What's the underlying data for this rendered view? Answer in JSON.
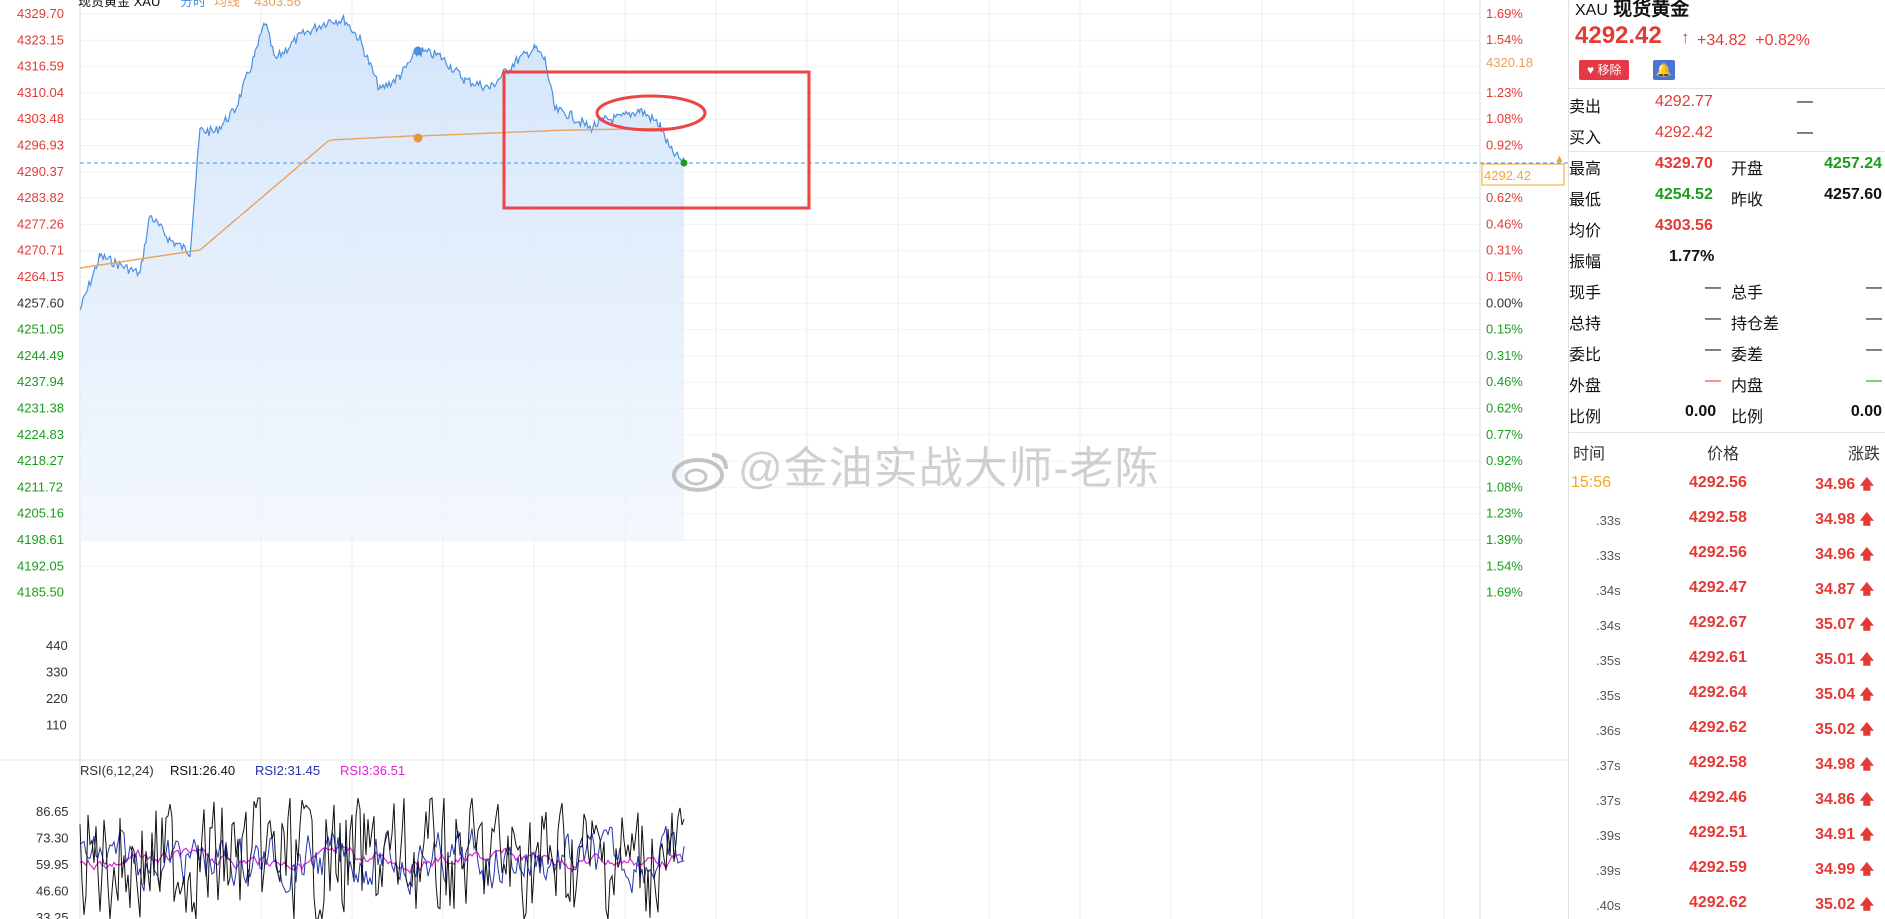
{
  "chart_header": {
    "title": "现货黄金 XAU",
    "legend_time_label": "分时",
    "legend_avg_label": "均线",
    "legend_avg_value": "4303.56"
  },
  "price_axis": {
    "left_ticks": [
      "4329.70",
      "4323.15",
      "4316.59",
      "4310.04",
      "4303.48",
      "4296.93",
      "4290.37",
      "4283.82",
      "4277.26",
      "4270.71",
      "4264.15",
      "4257.60",
      "4251.05",
      "4244.49",
      "4237.94",
      "4231.38",
      "4224.83",
      "4218.27",
      "4211.72",
      "4205.16",
      "4198.61",
      "4192.05",
      "4185.50"
    ],
    "right_ticks": [
      "1.69%",
      "1.54%",
      "1.23%",
      "1.08%",
      "0.92%",
      "0.77%",
      "0.62%",
      "0.46%",
      "0.31%",
      "0.15%",
      "0.00%",
      "0.15%",
      "0.31%",
      "0.46%",
      "0.62%",
      "0.77%",
      "0.92%",
      "1.08%",
      "1.23%",
      "1.39%",
      "1.54%",
      "1.69%"
    ],
    "avg_price_label": "4320.18",
    "current_price_label": "4292.42"
  },
  "volume_axis": {
    "ticks": [
      "440",
      "330",
      "220",
      "110"
    ]
  },
  "rsi": {
    "label": "RSI(6,12,24)",
    "rsi1": "RSI1:26.40",
    "rsi2": "RSI2:31.45",
    "rsi3": "RSI3:36.51",
    "ticks": [
      "86.65",
      "73.30",
      "59.95",
      "46.60",
      "33.25"
    ]
  },
  "colors": {
    "up": "#e53935",
    "down": "#1a9e1a",
    "price_line": "#4a90e2",
    "avg_line": "#e8a25c",
    "rsi1": "#111111",
    "rsi2": "#2233aa",
    "rsi3": "#dd22dd",
    "annotation": "#ee4444"
  },
  "watermark": "@金油实战大师-老陈",
  "side_panel": {
    "symbol": "XAU",
    "name": "现货黄金",
    "price": "4292.42",
    "change": "+34.82",
    "change_pct": "+0.82%",
    "remove_label": "移除",
    "bell_icon": "bell-icon",
    "sell_label": "卖出",
    "sell_price": "4292.77",
    "sell_vol": "—",
    "buy_label": "买入",
    "buy_price": "4292.42",
    "buy_vol": "—",
    "high_label": "最高",
    "high": "4329.70",
    "open_label": "开盘",
    "open": "4257.24",
    "low_label": "最低",
    "low": "4254.52",
    "prev_close_label": "昨收",
    "prev_close": "4257.60",
    "avg_label": "均价",
    "avg": "4303.56",
    "amplitude_label": "振幅",
    "amplitude": "1.77%",
    "cur_hand_label": "现手",
    "cur_hand": "—",
    "total_hand_label": "总手",
    "total_hand": "—",
    "total_hold_label": "总持",
    "total_hold": "—",
    "hold_diff_label": "持仓差",
    "hold_diff": "—",
    "entrust_ratio_label": "委比",
    "entrust_ratio": "—",
    "entrust_diff_label": "委差",
    "entrust_diff": "—",
    "outer_label": "外盘",
    "outer": "—",
    "inner_label": "内盘",
    "inner": "—",
    "ratio_label_1": "比例",
    "ratio_1": "0.00",
    "ratio_label_2": "比例",
    "ratio_2": "0.00",
    "ticks_header": {
      "time": "时间",
      "price": "价格",
      "change": "涨跌"
    },
    "ticks": [
      {
        "time": "15:56",
        "price": "4292.56",
        "change": "34.96"
      },
      {
        "time": ".33s",
        "price": "4292.58",
        "change": "34.98"
      },
      {
        "time": ".33s",
        "price": "4292.56",
        "change": "34.96"
      },
      {
        "time": ".34s",
        "price": "4292.47",
        "change": "34.87"
      },
      {
        "time": ".34s",
        "price": "4292.67",
        "change": "35.07"
      },
      {
        "time": ".35s",
        "price": "4292.61",
        "change": "35.01"
      },
      {
        "time": ".35s",
        "price": "4292.64",
        "change": "35.04"
      },
      {
        "time": ".36s",
        "price": "4292.62",
        "change": "35.02"
      },
      {
        "time": ".37s",
        "price": "4292.58",
        "change": "34.98"
      },
      {
        "time": ".37s",
        "price": "4292.46",
        "change": "34.86"
      },
      {
        "time": ".39s",
        "price": "4292.51",
        "change": "34.91"
      },
      {
        "time": ".39s",
        "price": "4292.59",
        "change": "34.99"
      },
      {
        "time": ".40s",
        "price": "4292.62",
        "change": "35.02"
      }
    ]
  }
}
